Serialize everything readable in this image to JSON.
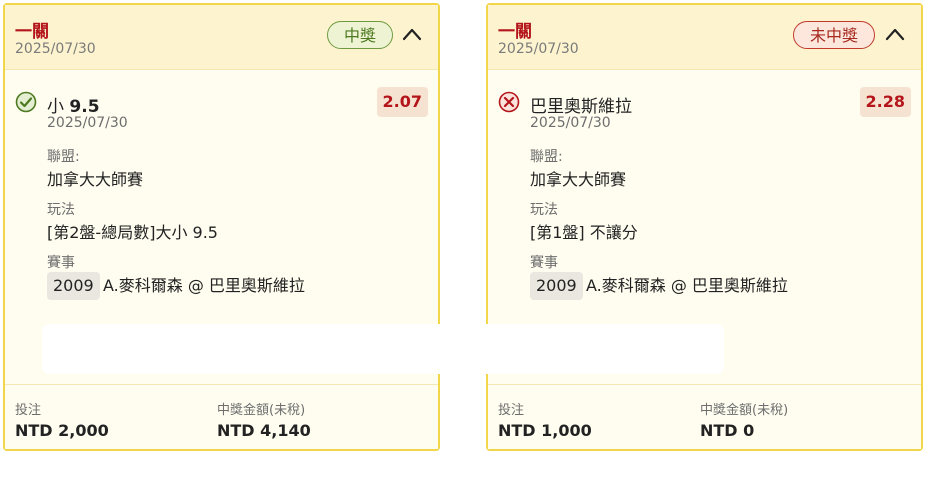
{
  "cards": [
    {
      "title": "一關",
      "date": "2025/07/30",
      "status": "中獎",
      "status_icon": "check-circle-icon",
      "selection_prefix": "小",
      "selection_value": "9.5",
      "odds": "2.07",
      "bet_date": "2025/07/30",
      "league_label": "聯盟:",
      "league": "加拿大大師賽",
      "play_label": "玩法",
      "play": "[第2盤-總局數]大小 9.5",
      "event_label": "賽事",
      "event_id": "2009",
      "event_name": "A.麥科爾森 @ 巴里奧斯維拉",
      "stake_label": "投注",
      "stake": "NTD 2,000",
      "payout_label": "中獎金額(未稅)",
      "payout": "NTD 4,140"
    },
    {
      "title": "一關",
      "date": "2025/07/30",
      "status": "未中獎",
      "status_icon": "x-circle-icon",
      "selection": "巴里奧斯維拉",
      "odds": "2.28",
      "bet_date": "2025/07/30",
      "league_label": "聯盟:",
      "league": "加拿大大師賽",
      "play_label": "玩法",
      "play": "[第1盤] 不讓分",
      "event_label": "賽事",
      "event_id": "2009",
      "event_name": "A.麥科爾森 @ 巴里奧斯維拉",
      "stake_label": "投注",
      "stake": "NTD 1,000",
      "payout_label": "中獎金額(未稅)",
      "payout": "NTD 0"
    }
  ],
  "colors": {
    "card_border": "#f1d64a",
    "header_bg": "#fdf4cf",
    "title_red": "#b4151b",
    "win_green": "#4d7a20",
    "lose_red": "#a62a1f"
  }
}
